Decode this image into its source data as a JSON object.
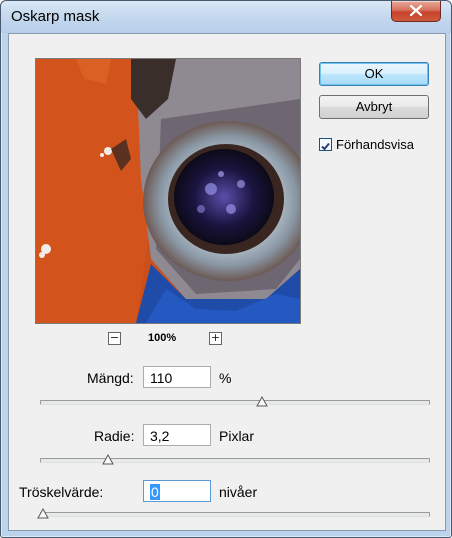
{
  "window": {
    "title": "Oskarp mask"
  },
  "buttons": {
    "ok": "OK",
    "cancel": "Avbryt"
  },
  "preview_checkbox": {
    "label": "Förhandsvisa",
    "checked": true
  },
  "zoom": {
    "level": "100%",
    "minus": "−",
    "plus": "+"
  },
  "amount": {
    "label": "Mängd:",
    "value": "110",
    "unit": "%",
    "slider_fraction": 0.44
  },
  "radius": {
    "label": "Radie:",
    "value": "3,2",
    "unit": "Pixlar",
    "slider_fraction": 0.16
  },
  "threshold": {
    "label": "Tröskelvärde:",
    "value": "0",
    "unit": "nivåer",
    "slider_fraction": 0.0
  },
  "colors": {
    "accent": "#3399ff",
    "close": "#c6432c",
    "titlebar": "#c4d8ee"
  }
}
